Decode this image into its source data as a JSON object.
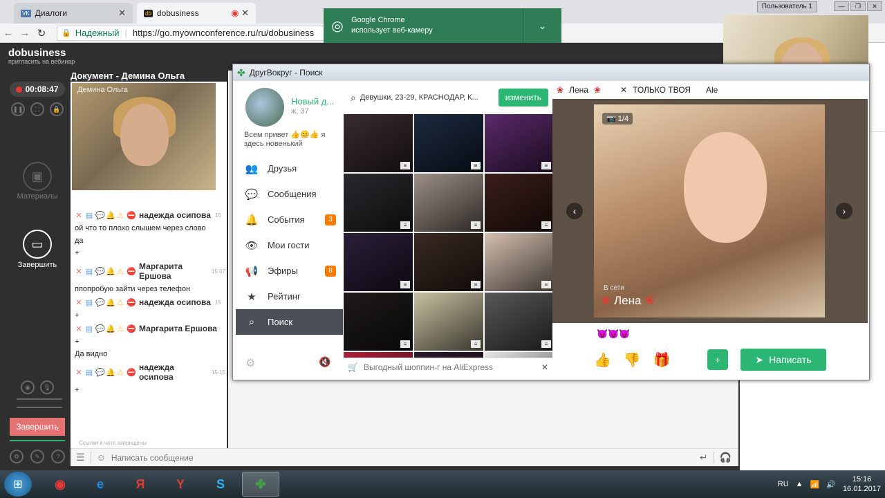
{
  "browser": {
    "tabs": [
      {
        "label": "Диалоги",
        "icon": "vk-icon"
      },
      {
        "label": "dobusiness",
        "icon": "dobusiness-icon"
      }
    ],
    "user_badge": "Пользователь 1",
    "secure_label": "Надежный",
    "url": "https://go.myownconference.ru/ru/dobusiness",
    "notification": {
      "line1": "Google Chrome",
      "line2": "использует веб-камеру"
    }
  },
  "conference": {
    "brand": "dobusiness",
    "brand_sub": "пригласить на вебинар",
    "timer": "00:08:47",
    "materials_label": "Материалы",
    "finish_label": "Завершить",
    "finish_button": "Завершить",
    "document_title": "Документ - Демина Ольга",
    "video_label": "Демина Ольга",
    "chat": [
      {
        "type": "name",
        "text": "надежда осипова",
        "time": "15"
      },
      {
        "type": "text",
        "text": "ой что то плохо слышем через слово"
      },
      {
        "type": "text",
        "text": "да"
      },
      {
        "type": "text",
        "text": "+"
      },
      {
        "type": "name",
        "text": "Маргарита Ершова",
        "time": "15:07"
      },
      {
        "type": "text",
        "text": "ппопробую зайти через телефон"
      },
      {
        "type": "name",
        "text": "надежда осипова",
        "time": "15"
      },
      {
        "type": "text",
        "text": "+"
      },
      {
        "type": "name",
        "text": "Маргарита Ершова",
        "time": ""
      },
      {
        "type": "text",
        "text": "+"
      },
      {
        "type": "text",
        "text": "Да видно"
      },
      {
        "type": "name",
        "text": "надежда осипова",
        "time": "15:15"
      },
      {
        "type": "text",
        "text": "+"
      }
    ],
    "links_notice": "Ссылки в чате запрещены",
    "input_placeholder": "Написать сообщение"
  },
  "dv": {
    "window_title": "ДругВокруг - Поиск",
    "user_name": "Новый д...",
    "user_age": "ж, 37",
    "status": "Всем привет 👍😊👍 я здесь новенький",
    "menu": [
      {
        "label": "Друзья",
        "icon": "friends-icon",
        "badge": ""
      },
      {
        "label": "Сообщения",
        "icon": "messages-icon",
        "badge": ""
      },
      {
        "label": "События",
        "icon": "bell-icon",
        "badge": "3"
      },
      {
        "label": "Мои гости",
        "icon": "eye-icon",
        "badge": ""
      },
      {
        "label": "Эфиры",
        "icon": "megaphone-icon",
        "badge": "8"
      },
      {
        "label": "Рейтинг",
        "icon": "star-icon",
        "badge": ""
      },
      {
        "label": "Поиск",
        "icon": "search-icon",
        "badge": ""
      }
    ],
    "search_query": "Девушки, 23-29, КРАСНОДАР, К...",
    "change_button": "изменить",
    "ad_text": "Выгодный шоппин-г на AliExpress",
    "profile_tabs": [
      "Лена",
      "ТОЛЬКО ТВОЯ",
      "Ale"
    ],
    "photo_counter": "1/4",
    "online_label": "В сети",
    "profile_name": "Лена",
    "emojis": "😈😈😈",
    "write_button": "Написать",
    "grid_colors": [
      "#3a2c2e",
      "#1c2a40",
      "#5b2a6a",
      "#2a2a2e",
      "#9c8f86",
      "#3b1e1a",
      "#2b1f3a",
      "#3a2a22",
      "#d6c0b0",
      "#1e1a1a",
      "#c8c0a0",
      "#585858",
      "#b0203a",
      "#2a1a2a",
      "#e8e8e8"
    ]
  },
  "taskbar": {
    "lang": "RU",
    "time": "15:16",
    "date": "16.01.2017",
    "apps": [
      {
        "name": "chrome-taskbar-icon",
        "glyph": "◉",
        "color": "#e53935"
      },
      {
        "name": "ie-taskbar-icon",
        "glyph": "e",
        "color": "#1e88e5"
      },
      {
        "name": "yandex-taskbar-icon",
        "glyph": "Я",
        "color": "#e53935"
      },
      {
        "name": "yandex-browser-taskbar-icon",
        "glyph": "Y",
        "color": "#e53935"
      },
      {
        "name": "skype-taskbar-icon",
        "glyph": "S",
        "color": "#29b6f6"
      },
      {
        "name": "drugvokrug-taskbar-icon",
        "glyph": "✤",
        "color": "#43a047"
      }
    ]
  }
}
